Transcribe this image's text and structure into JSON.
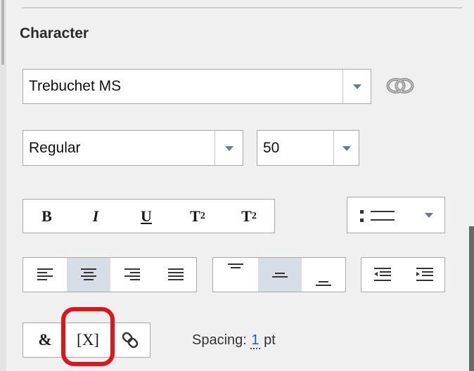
{
  "section": {
    "title": "Character"
  },
  "font": {
    "family": "Trebuchet MS",
    "style": "Regular",
    "size": "50"
  },
  "format_buttons": [
    {
      "name": "bold",
      "label": "B"
    },
    {
      "name": "italic",
      "label": "I"
    },
    {
      "name": "underline",
      "label": "U"
    },
    {
      "name": "superscript",
      "label": "T",
      "script": "2"
    },
    {
      "name": "subscript",
      "label": "T",
      "script": "2"
    }
  ],
  "horizontal_align": {
    "active": "center"
  },
  "vertical_align": {
    "active": "middle"
  },
  "insert_buttons": [
    {
      "name": "ampersand",
      "label": "&"
    },
    {
      "name": "variable",
      "label": "[X]"
    }
  ],
  "spacing": {
    "label": "Spacing:",
    "value": "1",
    "unit": "pt"
  },
  "colors": {
    "highlight": "#e0141b",
    "active_button": "#d6dde6",
    "link_text": "#1a5fb4"
  }
}
